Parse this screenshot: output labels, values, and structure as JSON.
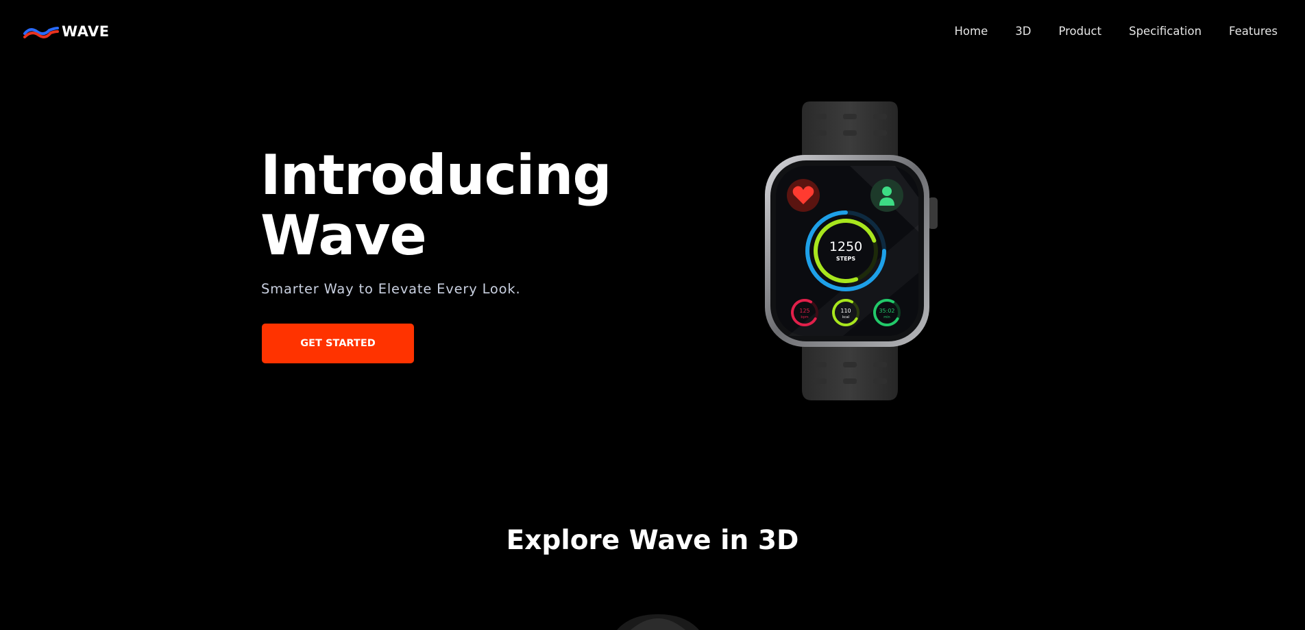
{
  "brand": {
    "name": "WAVE",
    "colors": {
      "wave_red": "#e8321f",
      "wave_blue": "#2a6bff"
    }
  },
  "nav": {
    "items": [
      {
        "label": "Home"
      },
      {
        "label": "3D"
      },
      {
        "label": "Product"
      },
      {
        "label": "Specification"
      },
      {
        "label": "Features"
      }
    ]
  },
  "hero": {
    "title_line1": "Introducing",
    "title_line2": "Wave",
    "subtitle": "Smarter Way to Elevate Every Look.",
    "cta_label": "GET STARTED",
    "cta_color": "#ff3300"
  },
  "watch": {
    "steps_value": "1250",
    "steps_label": "STEPS",
    "mini_rings": [
      {
        "value": "125",
        "unit": "bpm",
        "color": "#e0204a"
      },
      {
        "value": "110",
        "unit": "kcal",
        "color": "#a8e61e"
      },
      {
        "value": "35:02",
        "unit": "min",
        "color": "#22c96a"
      }
    ],
    "icons": [
      "heart-icon",
      "person-icon"
    ]
  },
  "explore": {
    "title": "Explore Wave in 3D"
  }
}
